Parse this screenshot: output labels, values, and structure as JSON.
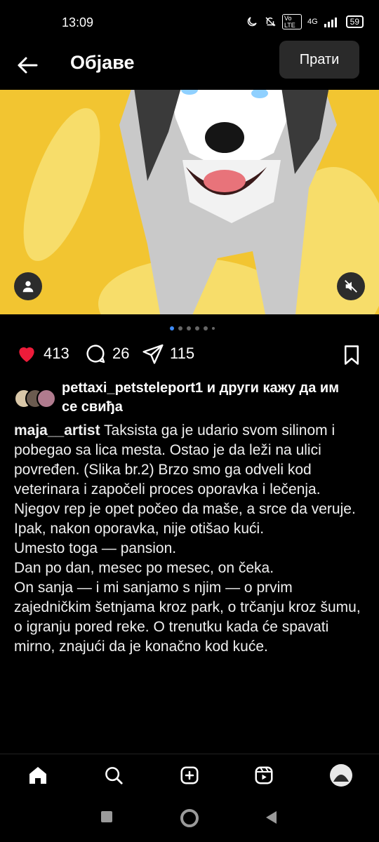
{
  "status_bar": {
    "time": "13:09",
    "icons": [
      "moon-icon",
      "bell-off-icon",
      "volte-icon",
      "4g-icon",
      "signal-icon",
      "battery-icon"
    ],
    "volte": "Vo LTE",
    "network": "4G",
    "battery": "59"
  },
  "header": {
    "title": "Објаве",
    "follow_label": "Прати"
  },
  "media": {
    "background_color": "#f2c531",
    "carousel_count": 6,
    "active_index": 0
  },
  "actions": {
    "likes": "413",
    "comments": "26",
    "shares": "115",
    "like_color": "#ed1c3a"
  },
  "liked_by": {
    "user": "pettaxi_petsteleport1",
    "rest": " и други кажу да им се свиђа"
  },
  "caption": {
    "user": "maja__artist",
    "paragraphs": [
      " Taksista ga je udario svom silinom i pobegao sa lica mesta. Ostao je da leži na ulici povređen. (Slika br.2)  Brzo smo ga odveli kod veterinara i započeli proces oporavka i lečenja.",
      "Njegov rep je opet počeo da maše, a srce da veruje.",
      "Ipak, nakon oporavka, nije otišao kući.",
      "Umesto toga — pansion.",
      "Dan po dan, mesec po mesec, on čeka.",
      "On sanja — i mi sanjamo s njim — o prvim zajedničkim šetnjama kroz park, o trčanju kroz šumu, o igranju pored reke. O trenutku kada će spavati mirno, znajući da je konačno kod kuće."
    ]
  },
  "bottom_nav": [
    "home-icon",
    "search-icon",
    "create-icon",
    "reels-icon",
    "profile-avatar"
  ]
}
